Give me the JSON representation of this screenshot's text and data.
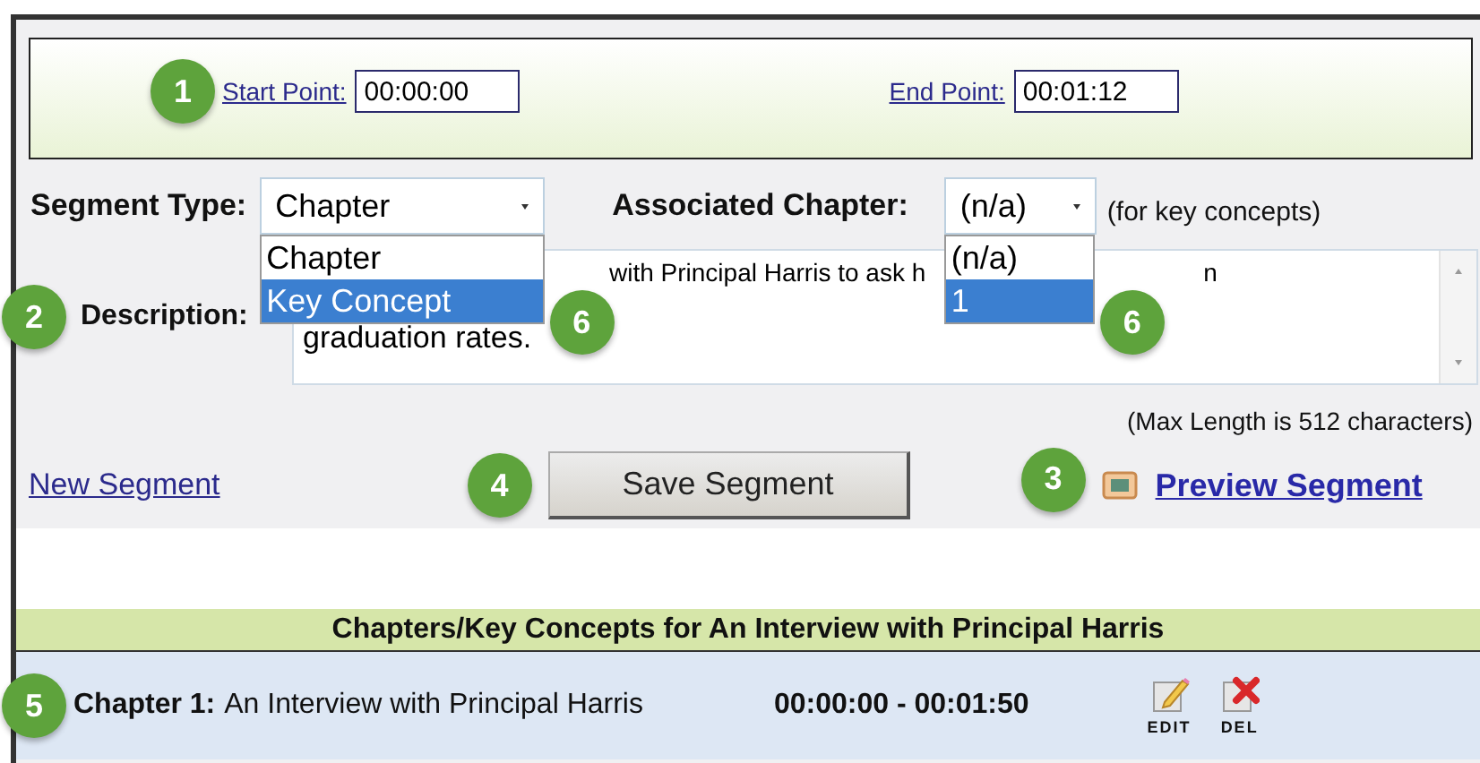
{
  "time_range": {
    "callout": "1",
    "start": {
      "label": "Start Point:",
      "value": "00:00:00"
    },
    "end": {
      "label": "End Point:",
      "value": "00:01:12"
    }
  },
  "segment_type": {
    "label": "Segment Type:",
    "value": "Chapter",
    "callout": "6",
    "options": [
      {
        "label": "Chapter",
        "highlighted": false
      },
      {
        "label": "Key Concept",
        "highlighted": true
      }
    ]
  },
  "associated_chapter": {
    "label": "Associated Chapter:",
    "value": "(n/a)",
    "hint": "(for key concepts)",
    "callout": "6",
    "options": [
      {
        "label": "(n/a)",
        "highlighted": false
      },
      {
        "label": "1",
        "highlighted": true
      }
    ]
  },
  "description": {
    "label": "Description:",
    "callout": "2",
    "visible_text": [
      "with Principal Harris to ask h",
      "n",
      "graduation rates."
    ],
    "note": "(Max Length is 512 characters)"
  },
  "actions": {
    "new_segment": "New Segment",
    "save": {
      "label": "Save Segment",
      "callout": "4"
    },
    "preview": {
      "label": "Preview Segment",
      "callout": "3"
    }
  },
  "segments": {
    "title": "Chapters/Key Concepts for An Interview with Principal Harris",
    "rows": [
      {
        "callout": "5",
        "heading": "Chapter 1:",
        "title": "An Interview with Principal Harris",
        "range": "00:00:00 - 00:01:50",
        "actions": [
          "EDIT",
          "DEL"
        ]
      }
    ]
  }
}
